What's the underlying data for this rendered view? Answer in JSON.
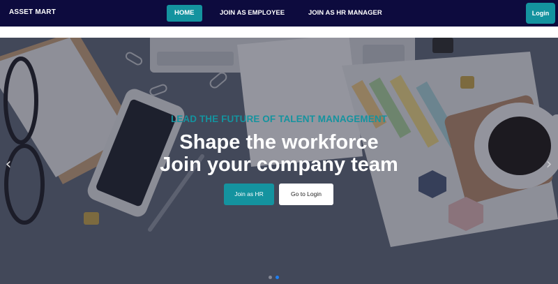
{
  "navbar": {
    "brand": "ASSET MART",
    "items": [
      {
        "label": "HOME",
        "active": true
      },
      {
        "label": "JOIN AS EMPLOYEE",
        "active": false
      },
      {
        "label": "JOIN AS HR MANAGER",
        "active": false
      }
    ],
    "login_label": "Login"
  },
  "hero": {
    "tagline": "LEAD THE FUTURE OF TALENT MANAGEMENT",
    "headline_line1": "Shape the workforce",
    "headline_line2": "Join your company team",
    "primary_button": "Join as HR",
    "secondary_button": "Go to Login",
    "prev_icon": "chevron-left-icon",
    "next_icon": "chevron-right-icon",
    "slide_count": 2,
    "active_slide": 2
  },
  "colors": {
    "navbar_bg": "#0d0b3e",
    "accent": "#14939f",
    "active_dot": "#1e7ff2"
  }
}
